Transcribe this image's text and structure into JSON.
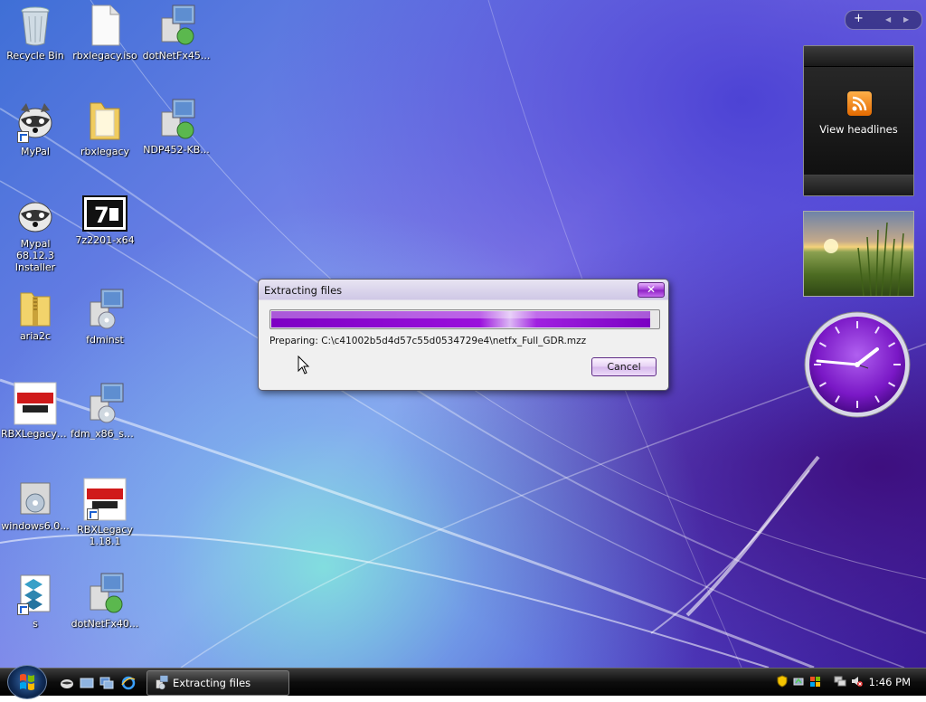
{
  "desktop": {
    "icons": [
      {
        "label": "Recycle Bin"
      },
      {
        "label": "rbxlegacy.iso"
      },
      {
        "label": "dotNetFx45..."
      },
      {
        "label": "MyPal"
      },
      {
        "label": "rbxlegacy"
      },
      {
        "label": "NDP452-KB..."
      },
      {
        "label": "Mypal 68.12.3 Installer"
      },
      {
        "label": "7z2201-x64"
      },
      {
        "label": "aria2c"
      },
      {
        "label": "fdminst"
      },
      {
        "label": "RBXLegacyS..."
      },
      {
        "label": "fdm_x86_se..."
      },
      {
        "label": "windows6.0..."
      },
      {
        "label": "RBXLegacy 1.18.1"
      },
      {
        "label": "s"
      },
      {
        "label": "dotNetFx40..."
      }
    ]
  },
  "gadgets": {
    "feeds_label": "View headlines",
    "sidebar_add": "+",
    "sidebar_prev": "◀",
    "sidebar_next": "▶"
  },
  "dialog": {
    "title": "Extracting files",
    "close": "✕",
    "progress_fraction": 0.98,
    "preparing_text": "Preparing: C:\\c41002b5d4d57c55d0534729e4\\netfx_Full_GDR.mzz",
    "cancel_label": "Cancel"
  },
  "taskbar": {
    "task_label": "Extracting files",
    "clock": "1:46 PM"
  },
  "colors": {
    "accent_purple": "#8b1ec2"
  }
}
